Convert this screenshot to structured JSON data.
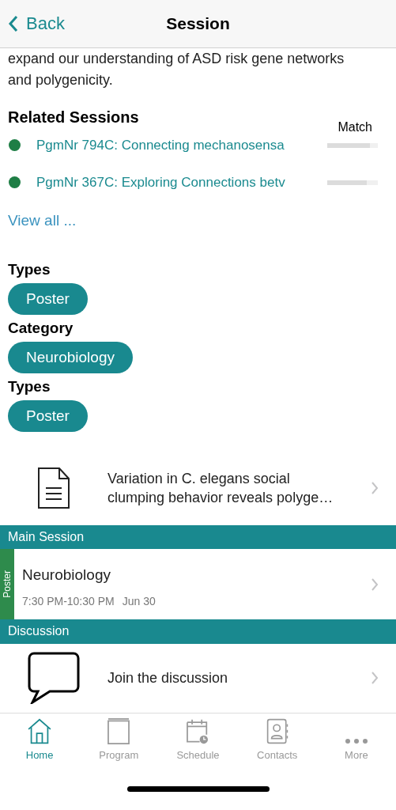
{
  "nav_bar": {
    "back": "Back",
    "title": "Session"
  },
  "abstract": {
    "lines": [
      "expand our understanding of ASD risk gene networks",
      "and polygenicity."
    ]
  },
  "related_sessions": {
    "heading": "Related Sessions",
    "match_label": "Match",
    "items": [
      {
        "title": "PgmNr 794C: Connecting mechanosensa",
        "color": "#1e7e45",
        "level": 0.85
      },
      {
        "title": "PgmNr 367C: Exploring Connections betv",
        "color": "#1e7e45",
        "level": 0.78
      }
    ],
    "view_all": "View all ..."
  },
  "tags": [
    {
      "heading": "Types",
      "chip": "Poster"
    },
    {
      "heading": "Category",
      "chip": "Neurobiology"
    },
    {
      "heading": "Types",
      "chip": "Poster"
    }
  ],
  "document": {
    "title": "Variation in C. elegans social clumping behavior reveals polyge…"
  },
  "main_session": {
    "header": "Main Session",
    "badge": "Poster",
    "title": "Neurobiology",
    "time": "7:30 PM-10:30 PM",
    "date": "Jun 30"
  },
  "discussion": {
    "header": "Discussion",
    "label": "Join the discussion"
  },
  "tab_bar": [
    {
      "kind": "home",
      "label": "Home",
      "selected": true
    },
    {
      "kind": "program",
      "label": "Program",
      "selected": false
    },
    {
      "kind": "schedule",
      "label": "Schedule",
      "selected": false
    },
    {
      "kind": "contacts",
      "label": "Contacts",
      "selected": false
    },
    {
      "kind": "more",
      "label": "More",
      "selected": false
    }
  ]
}
